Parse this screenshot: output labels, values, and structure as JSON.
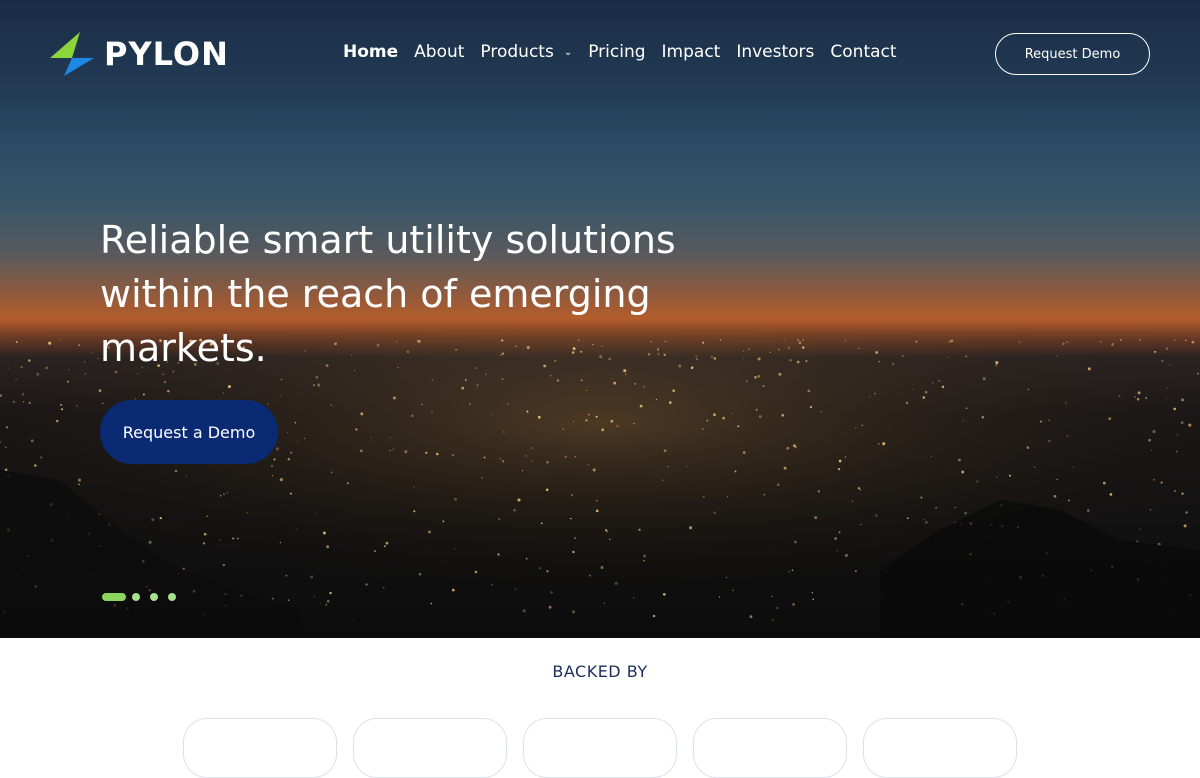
{
  "brand": {
    "name": "PYLON",
    "logo_icon": "lightning-bolt-logo",
    "colors": {
      "green": "#8bd43a",
      "blue": "#1e88e5"
    }
  },
  "nav": {
    "items": [
      {
        "label": "Home",
        "active": true
      },
      {
        "label": "About"
      },
      {
        "label": "Products",
        "dropdown": true
      },
      {
        "label": "Pricing"
      },
      {
        "label": "Impact"
      },
      {
        "label": "Investors"
      },
      {
        "label": "Contact"
      }
    ],
    "request_demo_label": "Request Demo"
  },
  "hero": {
    "headline": "Reliable smart utility solutions within the reach of emerging markets.",
    "cta_label": "Request a Demo",
    "slides_count": 4,
    "active_slide": 1,
    "cta_color": "#0a2a73",
    "dot_color": "#a5e08a"
  },
  "backed_by": {
    "title": "BACKED BY",
    "cards_count": 5
  }
}
